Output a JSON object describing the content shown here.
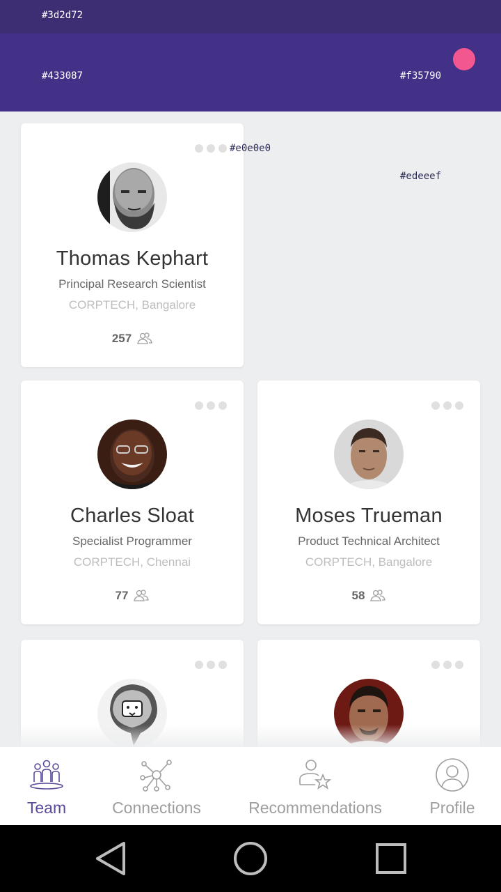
{
  "colors": {
    "status_bar": "#3d2d72",
    "app_bar": "#433087",
    "accent": "#f35790",
    "menu_dots": "#e0e0e0",
    "background": "#edeeef",
    "nav_active": "#5b4a9b",
    "nav_inactive": "#9e9e9e"
  },
  "labels": {
    "status_bar_hex": "#3d2d72",
    "app_bar_hex": "#433087",
    "accent_hex": "#f35790",
    "menu_dots_hex": "#e0e0e0",
    "background_hex": "#edeeef"
  },
  "team": [
    {
      "name": "Thomas Kephart",
      "title": "Principal Research Scientist",
      "company": "CORPTECH, Bangalore",
      "connections": "257",
      "avatar": "bald-man-photo"
    },
    {
      "name": "Charles Sloat",
      "title": "Specialist Programmer",
      "company": "CORPTECH, Chennai",
      "connections": "77",
      "avatar": "man-glasses-photo"
    },
    {
      "name": "Moses Trueman",
      "title": "Product Technical Architect",
      "company": "CORPTECH, Bangalore",
      "connections": "58",
      "avatar": "man-short-hair-photo"
    },
    {
      "avatar": "lion-sketch-avatar"
    },
    {
      "avatar": "man-portrait-photo"
    }
  ],
  "bottom_nav": {
    "items": [
      {
        "label": "Team",
        "icon": "team-icon",
        "active": true
      },
      {
        "label": "Connections",
        "icon": "connections-icon",
        "active": false
      },
      {
        "label": "Recommendations",
        "icon": "recommendations-icon",
        "active": false
      },
      {
        "label": "Profile",
        "icon": "profile-icon",
        "active": false
      }
    ]
  },
  "system_nav": {
    "buttons": [
      "back-icon",
      "home-icon",
      "recents-icon"
    ]
  }
}
